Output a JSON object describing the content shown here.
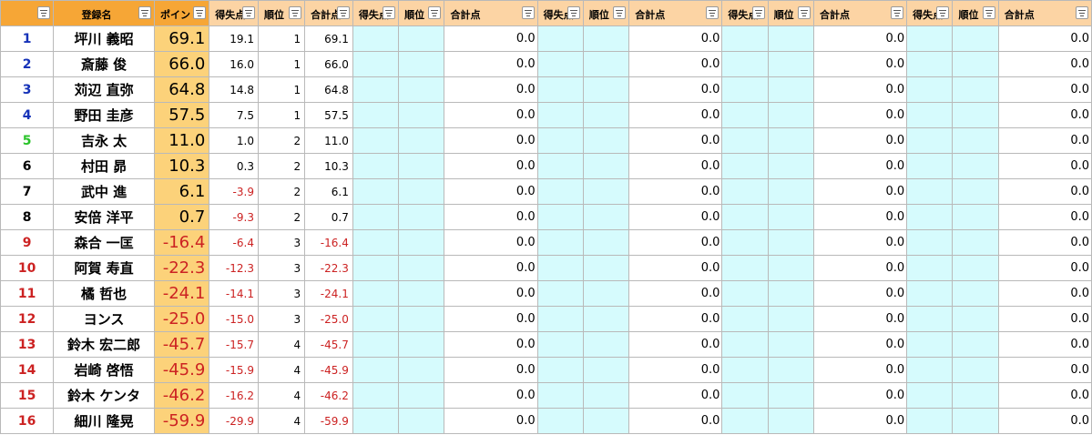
{
  "headers": {
    "name": "登録名",
    "points": "ポイン",
    "gain": "得失点",
    "position": "順位",
    "total": "合計点"
  },
  "colors": {
    "rank_blue": "#1532b8",
    "rank_green": "#29c329",
    "rank_black": "#000000",
    "rank_red": "#cc2222",
    "negative": "#cc2222"
  },
  "rows": [
    {
      "rank": "1",
      "rank_color": "blue",
      "name": "坪川 義昭",
      "points": "69.1",
      "gain": "19.1",
      "position": "1",
      "total": "69.1"
    },
    {
      "rank": "2",
      "rank_color": "blue",
      "name": "斎藤 俊",
      "points": "66.0",
      "gain": "16.0",
      "position": "1",
      "total": "66.0"
    },
    {
      "rank": "3",
      "rank_color": "blue",
      "name": "苅辺 直弥",
      "points": "64.8",
      "gain": "14.8",
      "position": "1",
      "total": "64.8"
    },
    {
      "rank": "4",
      "rank_color": "blue",
      "name": "野田 圭彦",
      "points": "57.5",
      "gain": "7.5",
      "position": "1",
      "total": "57.5"
    },
    {
      "rank": "5",
      "rank_color": "green",
      "name": "吉永 太",
      "points": "11.0",
      "gain": "1.0",
      "position": "2",
      "total": "11.0"
    },
    {
      "rank": "6",
      "rank_color": "black",
      "name": "村田 昴",
      "points": "10.3",
      "gain": "0.3",
      "position": "2",
      "total": "10.3"
    },
    {
      "rank": "7",
      "rank_color": "black",
      "name": "武中 進",
      "points": "6.1",
      "gain": "-3.9",
      "position": "2",
      "total": "6.1"
    },
    {
      "rank": "8",
      "rank_color": "black",
      "name": "安倍 洋平",
      "points": "0.7",
      "gain": "-9.3",
      "position": "2",
      "total": "0.7"
    },
    {
      "rank": "9",
      "rank_color": "red",
      "name": "森合 一匡",
      "points": "-16.4",
      "gain": "-6.4",
      "position": "3",
      "total": "-16.4"
    },
    {
      "rank": "10",
      "rank_color": "red",
      "name": "阿賀 寿直",
      "points": "-22.3",
      "gain": "-12.3",
      "position": "3",
      "total": "-22.3"
    },
    {
      "rank": "11",
      "rank_color": "red",
      "name": "橘 哲也",
      "points": "-24.1",
      "gain": "-14.1",
      "position": "3",
      "total": "-24.1"
    },
    {
      "rank": "12",
      "rank_color": "red",
      "name": "ヨンス",
      "points": "-25.0",
      "gain": "-15.0",
      "position": "3",
      "total": "-25.0"
    },
    {
      "rank": "13",
      "rank_color": "red",
      "name": "鈴木 宏二郎",
      "points": "-45.7",
      "gain": "-15.7",
      "position": "4",
      "total": "-45.7"
    },
    {
      "rank": "14",
      "rank_color": "red",
      "name": "岩崎 啓悟",
      "points": "-45.9",
      "gain": "-15.9",
      "position": "4",
      "total": "-45.9"
    },
    {
      "rank": "15",
      "rank_color": "red",
      "name": "鈴木 ケンタ",
      "points": "-46.2",
      "gain": "-16.2",
      "position": "4",
      "total": "-46.2"
    },
    {
      "rank": "16",
      "rank_color": "red",
      "name": "細川 隆晃",
      "points": "-59.9",
      "gain": "-29.9",
      "position": "4",
      "total": "-59.9"
    }
  ],
  "zero_value": "0.0"
}
